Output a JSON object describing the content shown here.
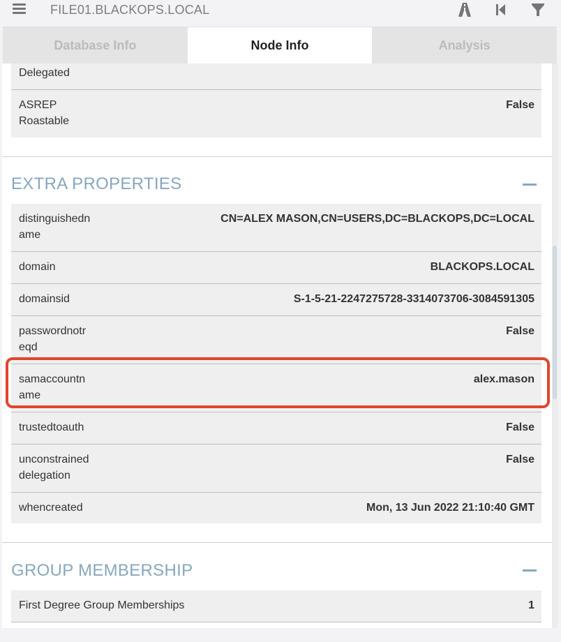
{
  "header": {
    "search_value": "FILE01.BLACKOPS.LOCAL",
    "icons": [
      "menu-icon",
      "pathfinding-icon",
      "back-icon",
      "filter-icon"
    ]
  },
  "tabs": [
    {
      "label": "Database Info",
      "active": false
    },
    {
      "label": "Node Info",
      "active": true
    },
    {
      "label": "Analysis",
      "active": false
    }
  ],
  "node_properties": [
    {
      "key": "Delegated",
      "value": ""
    },
    {
      "key": "ASREP\nRoastable",
      "value": "False"
    }
  ],
  "extra_properties": {
    "title": "EXTRA PROPERTIES",
    "rows": [
      {
        "key": "distinguishedn\name",
        "value": "CN=ALEX MASON,CN=USERS,DC=BLACKOPS,DC=LOCAL"
      },
      {
        "key": "domain",
        "value": "BLACKOPS.LOCAL"
      },
      {
        "key": "domainsid",
        "value": "S-1-5-21-2247275728-3314073706-3084591305"
      },
      {
        "key": "passwordnotr\neqd",
        "value": "False"
      },
      {
        "key": "samaccountn\name",
        "value": "alex.mason"
      },
      {
        "key": "trustedtoauth",
        "value": "False"
      },
      {
        "key": "unconstrained\ndelegation",
        "value": "False"
      },
      {
        "key": "whencreated",
        "value": "Mon, 13 Jun 2022 21:10:40 GMT"
      }
    ]
  },
  "group_membership": {
    "title": "GROUP MEMBERSHIP",
    "rows": [
      {
        "key": "First Degree Group Memberships",
        "value": "1"
      }
    ]
  },
  "colors": {
    "accent": "#87a7be",
    "highlight": "#e0452f"
  }
}
